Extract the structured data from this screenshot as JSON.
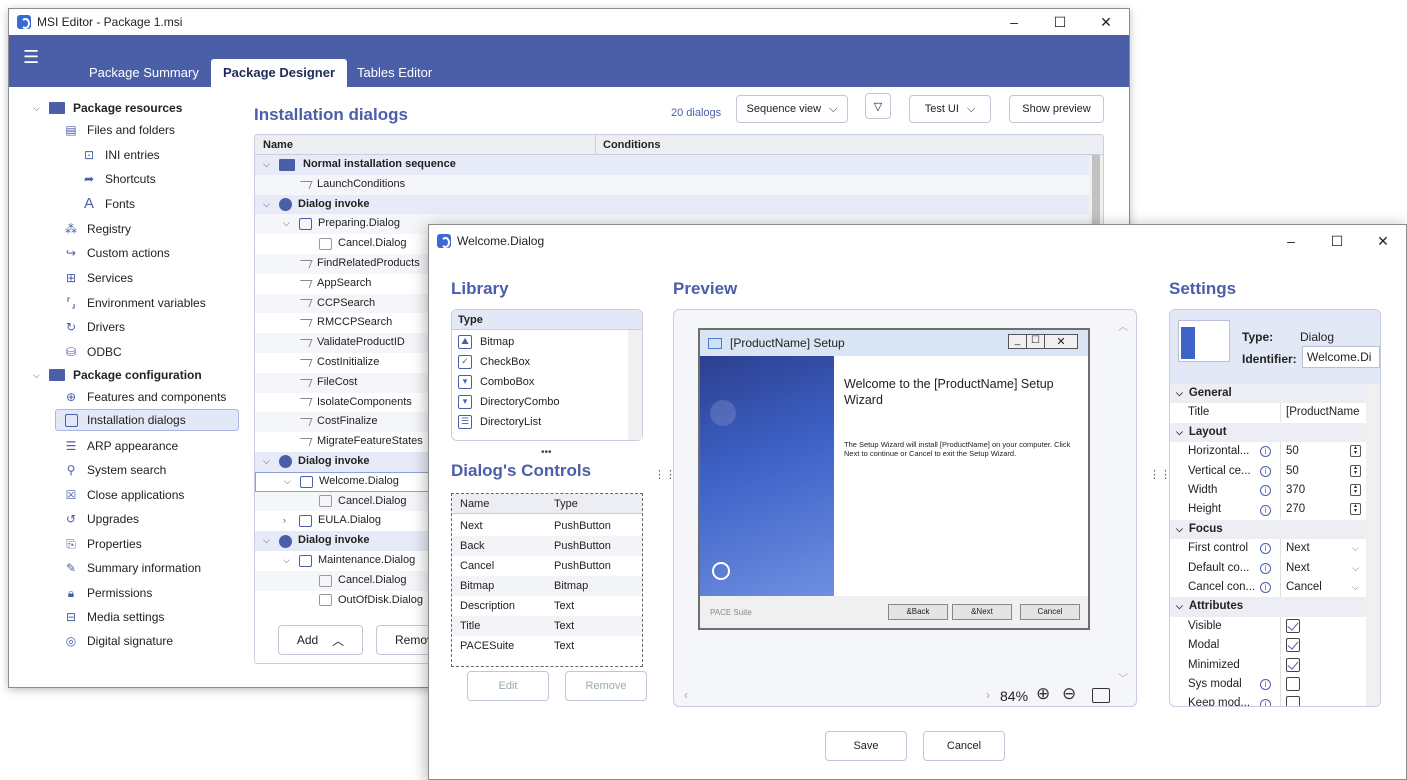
{
  "main_window": {
    "title": "MSI Editor - Package 1.msi",
    "controls": [
      "–",
      "☐",
      "✕"
    ],
    "tabs": [
      "Package Summary",
      "Package Designer",
      "Tables Editor"
    ],
    "active_tab": "Package Designer"
  },
  "tree": {
    "resources_header": "Package resources",
    "resources": [
      "Files and folders",
      "INI entries",
      "Shortcuts",
      "Fonts",
      "Registry",
      "Custom actions",
      "Services",
      "Environment variables",
      "Drivers",
      "ODBC"
    ],
    "config_header": "Package configuration",
    "config": [
      "Features and components",
      "Installation dialogs",
      "ARP appearance",
      "System search",
      "Close applications",
      "Upgrades",
      "Properties",
      "Summary information",
      "Permissions",
      "Media settings",
      "Digital signature"
    ]
  },
  "content": {
    "title": "Installation dialogs",
    "count": "20 dialogs",
    "view_select": "Sequence view",
    "test_button": "Test UI",
    "preview_button": "Show preview",
    "col_name": "Name",
    "col_conditions": "Conditions",
    "add_button": "Add",
    "remove_button": "Remov",
    "rows": [
      {
        "label": "Normal installation sequence",
        "kind": "folder",
        "bold": true
      },
      {
        "label": "LaunchConditions",
        "kind": "link"
      },
      {
        "label": "Dialog invoke",
        "kind": "dot",
        "bold": true
      },
      {
        "label": "Preparing.Dialog",
        "kind": "dlg"
      },
      {
        "label": "Cancel.Dialog",
        "kind": "dlggrey"
      },
      {
        "label": "FindRelatedProducts",
        "kind": "link"
      },
      {
        "label": "AppSearch",
        "kind": "link"
      },
      {
        "label": "CCPSearch",
        "kind": "link"
      },
      {
        "label": "RMCCPSearch",
        "kind": "link"
      },
      {
        "label": "ValidateProductID",
        "kind": "link"
      },
      {
        "label": "CostInitialize",
        "kind": "link"
      },
      {
        "label": "FileCost",
        "kind": "link"
      },
      {
        "label": "IsolateComponents",
        "kind": "link"
      },
      {
        "label": "CostFinalize",
        "kind": "link"
      },
      {
        "label": "MigrateFeatureStates",
        "kind": "link"
      },
      {
        "label": "Dialog invoke",
        "kind": "dot",
        "bold": true
      },
      {
        "label": "Welcome.Dialog",
        "kind": "dlg"
      },
      {
        "label": "Cancel.Dialog",
        "kind": "dlggrey"
      },
      {
        "label": "EULA.Dialog",
        "kind": "dlg"
      },
      {
        "label": "Dialog invoke",
        "kind": "dot",
        "bold": true
      },
      {
        "label": "Maintenance.Dialog",
        "kind": "dlg"
      },
      {
        "label": "Cancel.Dialog",
        "kind": "dlggrey"
      },
      {
        "label": "OutOfDisk.Dialog",
        "kind": "dlggrey"
      }
    ]
  },
  "dialog_window": {
    "title": "Welcome.Dialog",
    "controls": [
      "–",
      "☐",
      "✕"
    ],
    "library_title": "Library",
    "library_col": "Type",
    "library_items": [
      "Bitmap",
      "CheckBox",
      "ComboBox",
      "DirectoryCombo",
      "DirectoryList"
    ],
    "controls_title": "Dialog's Controls",
    "controls_cols": [
      "Name",
      "Type"
    ],
    "controls_rows": [
      [
        "Next",
        "PushButton"
      ],
      [
        "Back",
        "PushButton"
      ],
      [
        "Cancel",
        "PushButton"
      ],
      [
        "Bitmap",
        "Bitmap"
      ],
      [
        "Description",
        "Text"
      ],
      [
        "Title",
        "Text"
      ],
      [
        "PACESuite",
        "Text"
      ]
    ],
    "edit_button": "Edit",
    "remove_button": "Remove",
    "preview_title": "Preview",
    "zoom": "84%",
    "save_button": "Save",
    "cancel_button": "Cancel"
  },
  "setup_preview": {
    "window_title": "[ProductName] Setup",
    "heading": "Welcome to the [ProductName] Setup Wizard",
    "body": "The Setup Wizard will install [ProductName] on your computer. Click Next to continue or Cancel to exit the Setup Wizard.",
    "brand": "PACE Suite",
    "buttons": [
      "&Back",
      "&Next",
      "Cancel"
    ]
  },
  "settings": {
    "title": "Settings",
    "type_label": "Type:",
    "type_value": "Dialog",
    "identifier_label": "Identifier:",
    "identifier_value": "Welcome.Di",
    "sections": {
      "general": "General",
      "layout": "Layout",
      "focus": "Focus",
      "attributes": "Attributes"
    },
    "title_label": "Title",
    "title_value": "[ProductName",
    "horizontal_label": "Horizontal...",
    "horizontal_value": "50",
    "vertical_label": "Vertical ce...",
    "vertical_value": "50",
    "width_label": "Width",
    "width_value": "370",
    "height_label": "Height",
    "height_value": "270",
    "first_control_label": "First control",
    "first_control_value": "Next",
    "default_control_label": "Default co...",
    "default_control_value": "Next",
    "cancel_control_label": "Cancel con...",
    "cancel_control_value": "Cancel",
    "visible_label": "Visible",
    "visible": true,
    "modal_label": "Modal",
    "modal": true,
    "minimized_label": "Minimized",
    "minimized": true,
    "sysmodal_label": "Sys modal",
    "sysmodal": false,
    "keepmodal_label": "Keep mod...",
    "keepmodal": false
  },
  "colors": {
    "accent": "#4a5fa8",
    "selection": "#e3e8f6"
  }
}
